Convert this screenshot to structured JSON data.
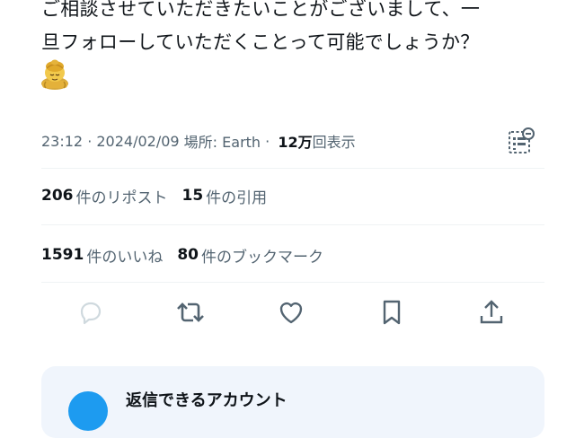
{
  "tweet": {
    "lines": [
      "ご相談させていただきたいことがございまして、一",
      "旦フォローしていただくことって可能でしょうか？"
    ],
    "emoji": "person-bowing-emoji"
  },
  "meta": {
    "time": "23:12",
    "separator1": " · ",
    "date": "2024/02/09",
    "location": " 場所: Earth",
    "separator2": " · ",
    "views_count": "12万",
    "views_label": "回表示"
  },
  "stats_row1": [
    {
      "count": "206",
      "label": "件のリポスト"
    },
    {
      "count": "15",
      "label": "件の引用"
    }
  ],
  "stats_row2": [
    {
      "count": "1591",
      "label": "件のいいね"
    },
    {
      "count": "80",
      "label": "件のブックマーク"
    }
  ],
  "actions": {
    "icons": [
      "reply-icon",
      "retweet-icon",
      "like-icon",
      "bookmark-icon",
      "share-icon"
    ]
  },
  "reply_card": {
    "title": "返信できるアカウント"
  },
  "colors": {
    "text": "#0f1419",
    "muted": "#536471",
    "divider": "#eff3f4",
    "card_bg": "#f0f5fc",
    "accent": "#1d9bf0"
  }
}
